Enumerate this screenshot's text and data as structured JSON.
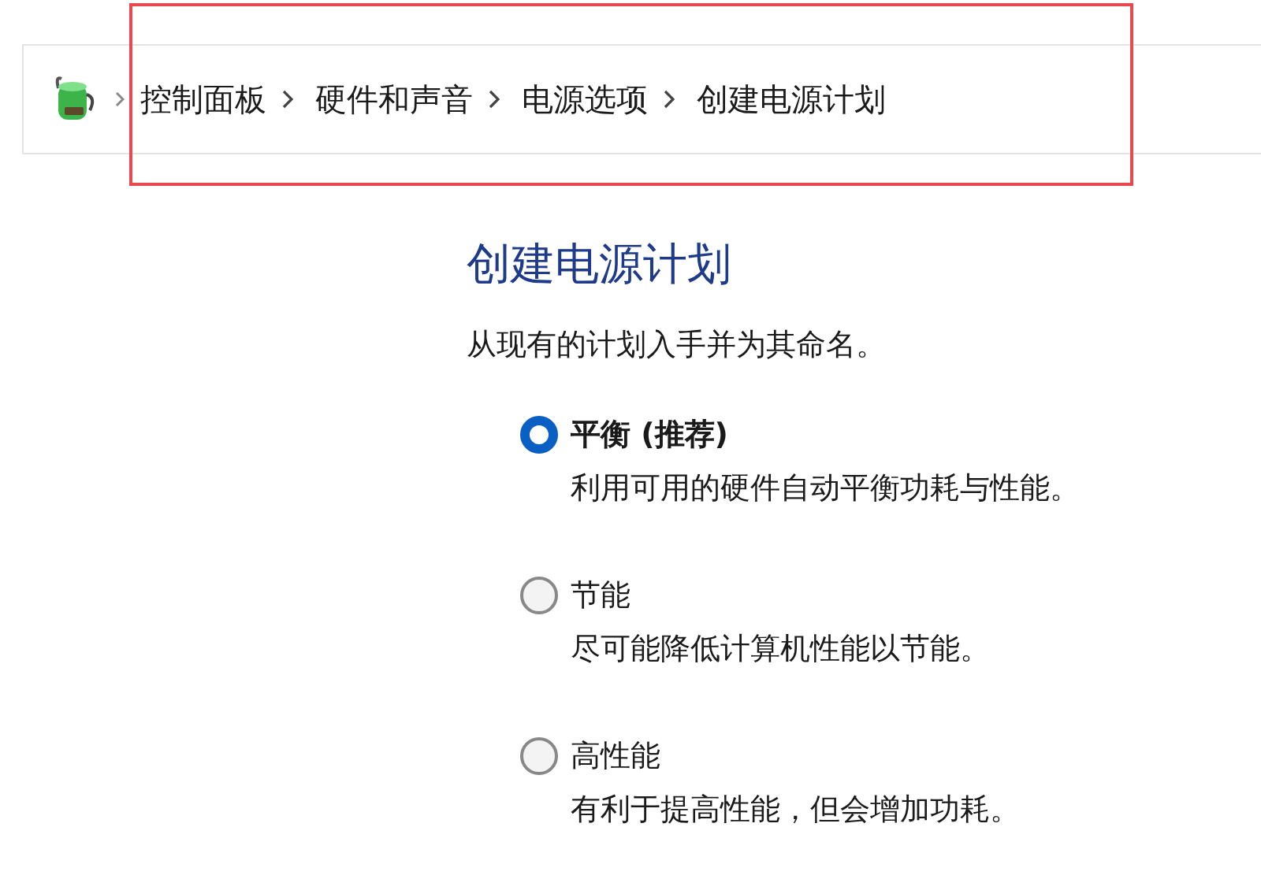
{
  "breadcrumb": {
    "items": [
      "控制面板",
      "硬件和声音",
      "电源选项",
      "创建电源计划"
    ]
  },
  "title": "创建电源计划",
  "subtitle": "从现有的计划入手并为其命名。",
  "plans": [
    {
      "label": "平衡 (推荐)",
      "description": "利用可用的硬件自动平衡功耗与性能。",
      "selected": true
    },
    {
      "label": "节能",
      "description": "尽可能降低计算机性能以节能。",
      "selected": false
    },
    {
      "label": "高性能",
      "description": "有利于提高性能，但会增加功耗。",
      "selected": false
    }
  ]
}
